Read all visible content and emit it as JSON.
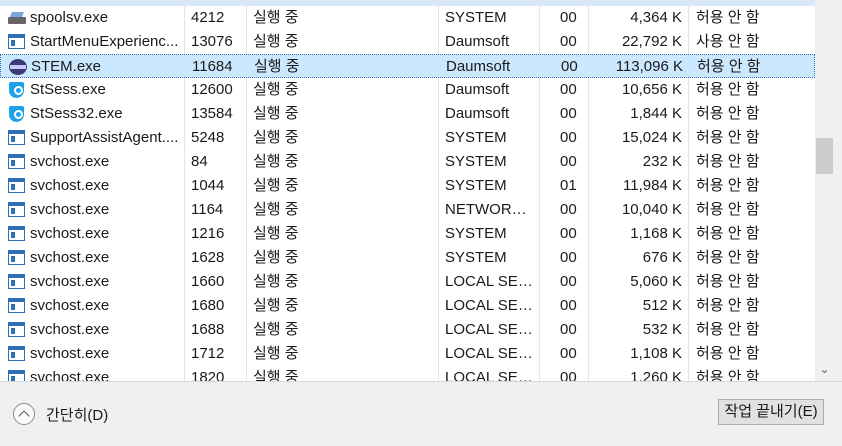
{
  "processes": [
    {
      "name": "spoolsv.exe",
      "pid": "4212",
      "status": "실행 중",
      "user": "SYSTEM",
      "cpu": "00",
      "memory": "4,364 K",
      "uac": "허용 안 함",
      "icon": "printer-icon"
    },
    {
      "name": "StartMenuExperienc...",
      "pid": "13076",
      "status": "실행 중",
      "user": "Daumsoft",
      "cpu": "00",
      "memory": "22,792 K",
      "uac": "사용 안 함",
      "icon": "app-window-icon"
    },
    {
      "name": "STEM.exe",
      "pid": "11684",
      "status": "실행 중",
      "user": "Daumsoft",
      "cpu": "00",
      "memory": "113,096 K",
      "uac": "허용 안 함",
      "icon": "stem-icon"
    },
    {
      "name": "StSess.exe",
      "pid": "12600",
      "status": "실행 중",
      "user": "Daumsoft",
      "cpu": "00",
      "memory": "10,656 K",
      "uac": "허용 안 함",
      "icon": "shield-icon"
    },
    {
      "name": "StSess32.exe",
      "pid": "13584",
      "status": "실행 중",
      "user": "Daumsoft",
      "cpu": "00",
      "memory": "1,844 K",
      "uac": "허용 안 함",
      "icon": "shield-icon"
    },
    {
      "name": "SupportAssistAgent....",
      "pid": "5248",
      "status": "실행 중",
      "user": "SYSTEM",
      "cpu": "00",
      "memory": "15,024 K",
      "uac": "허용 안 함",
      "icon": "app-window-icon"
    },
    {
      "name": "svchost.exe",
      "pid": "84",
      "status": "실행 중",
      "user": "SYSTEM",
      "cpu": "00",
      "memory": "232 K",
      "uac": "허용 안 함",
      "icon": "app-window-icon"
    },
    {
      "name": "svchost.exe",
      "pid": "1044",
      "status": "실행 중",
      "user": "SYSTEM",
      "cpu": "01",
      "memory": "11,984 K",
      "uac": "허용 안 함",
      "icon": "app-window-icon"
    },
    {
      "name": "svchost.exe",
      "pid": "1164",
      "status": "실행 중",
      "user": "NETWORK ...",
      "cpu": "00",
      "memory": "10,040 K",
      "uac": "허용 안 함",
      "icon": "app-window-icon"
    },
    {
      "name": "svchost.exe",
      "pid": "1216",
      "status": "실행 중",
      "user": "SYSTEM",
      "cpu": "00",
      "memory": "1,168 K",
      "uac": "허용 안 함",
      "icon": "app-window-icon"
    },
    {
      "name": "svchost.exe",
      "pid": "1628",
      "status": "실행 중",
      "user": "SYSTEM",
      "cpu": "00",
      "memory": "676 K",
      "uac": "허용 안 함",
      "icon": "app-window-icon"
    },
    {
      "name": "svchost.exe",
      "pid": "1660",
      "status": "실행 중",
      "user": "LOCAL SER...",
      "cpu": "00",
      "memory": "5,060 K",
      "uac": "허용 안 함",
      "icon": "app-window-icon"
    },
    {
      "name": "svchost.exe",
      "pid": "1680",
      "status": "실행 중",
      "user": "LOCAL SER...",
      "cpu": "00",
      "memory": "512 K",
      "uac": "허용 안 함",
      "icon": "app-window-icon"
    },
    {
      "name": "svchost.exe",
      "pid": "1688",
      "status": "실행 중",
      "user": "LOCAL SER...",
      "cpu": "00",
      "memory": "532 K",
      "uac": "허용 안 함",
      "icon": "app-window-icon"
    },
    {
      "name": "svchost.exe",
      "pid": "1712",
      "status": "실행 중",
      "user": "LOCAL SER...",
      "cpu": "00",
      "memory": "1,108 K",
      "uac": "허용 안 함",
      "icon": "app-window-icon"
    },
    {
      "name": "svchost.exe",
      "pid": "1820",
      "status": "실행 중",
      "user": "LOCAL SER...",
      "cpu": "00",
      "memory": "1,260 K",
      "uac": "허용 안 함",
      "icon": "app-window-icon"
    }
  ],
  "selected_process": "STEM.exe",
  "footer": {
    "collapse_label": "간단히(D)",
    "end_task_label": "작업 끝내기(E)"
  },
  "colors": {
    "selection_bg": "#cce8ff",
    "selection_border": "#3a73b8",
    "footer_bg": "#f0f0f0"
  }
}
